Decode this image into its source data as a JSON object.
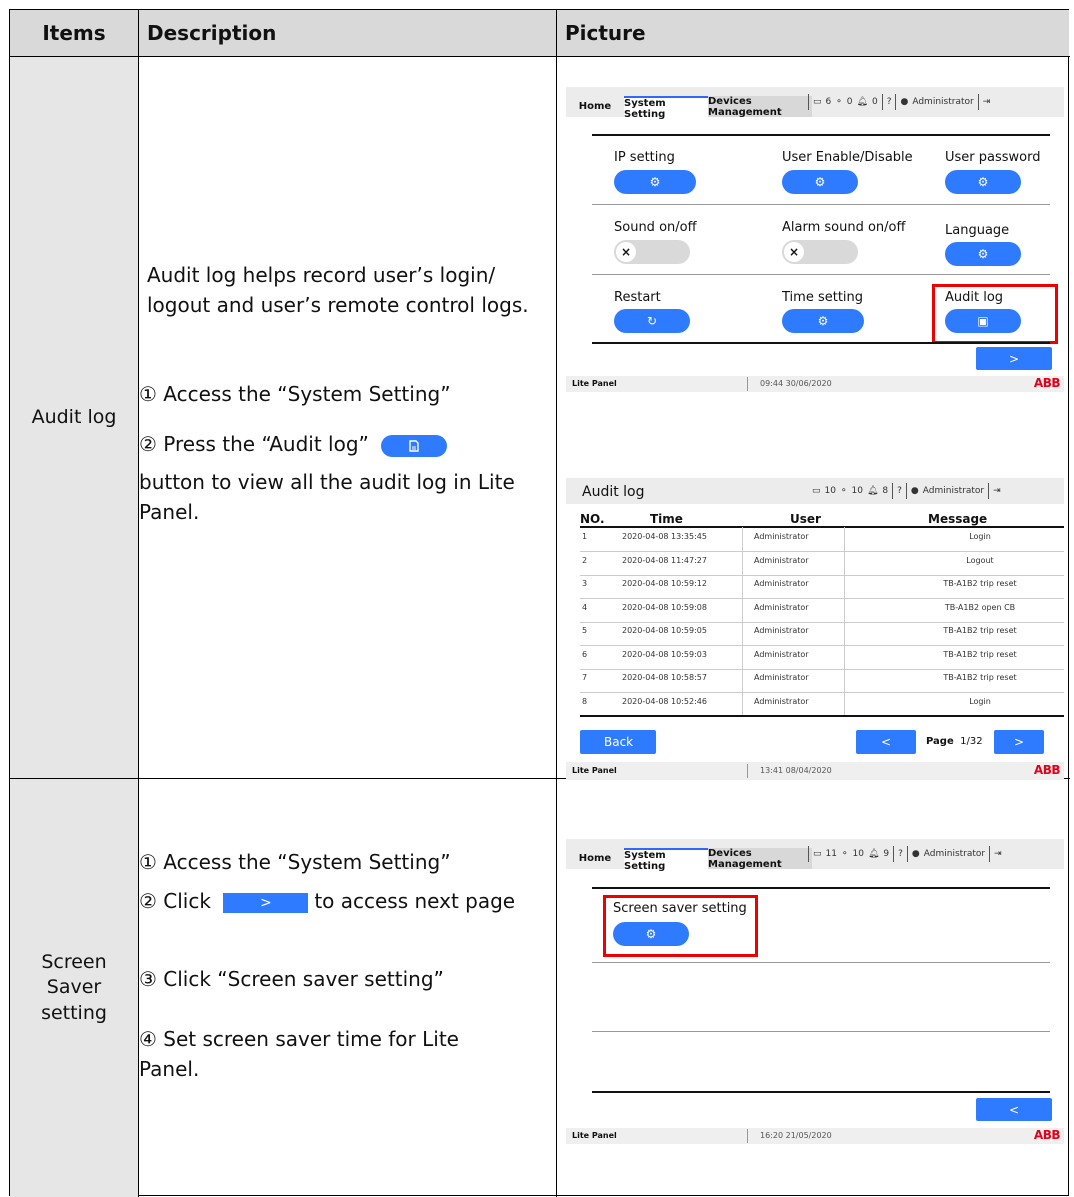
{
  "table": {
    "headers": {
      "items": "Items",
      "description": "Description",
      "picture": "Picture"
    },
    "rows": [
      {
        "item": "Audit log",
        "description": {
          "intro": "Audit log helps record user’s login/ logout and user’s remote control logs.",
          "step1": "① Access the “System Setting”",
          "step2a": "② Press the “Audit log”",
          "step2b": "button to view all the audit log in Lite Panel."
        }
      },
      {
        "item": "Screen Saver setting",
        "description": {
          "step1": "① Access the “System Setting”",
          "step2a": "② Click",
          "step2b": "to access next page",
          "step3": "③ Click “Screen saver setting”",
          "step4": "④ Set screen saver time for Lite Panel."
        }
      }
    ]
  },
  "screen1": {
    "tabs": {
      "home": "Home",
      "system": "System Setting",
      "devices": "Devices Management"
    },
    "status": {
      "screens": "6",
      "devices": "0",
      "alarms": "0",
      "user": "Administrator"
    },
    "settings": [
      {
        "label": "IP setting"
      },
      {
        "label": "User Enable/Disable"
      },
      {
        "label": "User password"
      },
      {
        "label": "Sound on/off"
      },
      {
        "label": "Alarm sound on/off"
      },
      {
        "label": "Language"
      },
      {
        "label": "Restart"
      },
      {
        "label": "Time setting"
      },
      {
        "label": "Audit log"
      }
    ],
    "next": ">",
    "footer": {
      "panel": "Lite Panel",
      "time": "09:44 30/06/2020",
      "logo": "ABB"
    }
  },
  "screen2": {
    "title": "Audit log",
    "status": {
      "screens": "10",
      "devices": "10",
      "alarms": "8",
      "user": "Administrator"
    },
    "columns": {
      "no": "NO.",
      "time": "Time",
      "user": "User",
      "message": "Message"
    },
    "rows": [
      {
        "no": "1",
        "time": "2020-04-08 13:35:45",
        "user": "Administrator",
        "message": "Login"
      },
      {
        "no": "2",
        "time": "2020-04-08 11:47:27",
        "user": "Administrator",
        "message": "Logout"
      },
      {
        "no": "3",
        "time": "2020-04-08 10:59:12",
        "user": "Administrator",
        "message": "TB-A1B2 trip reset"
      },
      {
        "no": "4",
        "time": "2020-04-08 10:59:08",
        "user": "Administrator",
        "message": "TB-A1B2 open CB"
      },
      {
        "no": "5",
        "time": "2020-04-08 10:59:05",
        "user": "Administrator",
        "message": "TB-A1B2 trip reset"
      },
      {
        "no": "6",
        "time": "2020-04-08 10:59:03",
        "user": "Administrator",
        "message": "TB-A1B2 trip reset"
      },
      {
        "no": "7",
        "time": "2020-04-08 10:58:57",
        "user": "Administrator",
        "message": "TB-A1B2 trip reset"
      },
      {
        "no": "8",
        "time": "2020-04-08 10:52:46",
        "user": "Administrator",
        "message": "Login"
      }
    ],
    "back": "Back",
    "prev": "<",
    "page_label": "Page",
    "page_value": "1/32",
    "next": ">",
    "footer": {
      "panel": "Lite Panel",
      "time": "13:41 08/04/2020",
      "logo": "ABB"
    }
  },
  "screen3": {
    "tabs": {
      "home": "Home",
      "system": "System Setting",
      "devices": "Devices Management"
    },
    "status": {
      "screens": "11",
      "devices": "10",
      "alarms": "9",
      "user": "Administrator"
    },
    "setting_label": "Screen saver setting",
    "prev": "<",
    "footer": {
      "panel": "Lite Panel",
      "time": "16:20 21/05/2020",
      "logo": "ABB"
    }
  },
  "inline_next": ">"
}
